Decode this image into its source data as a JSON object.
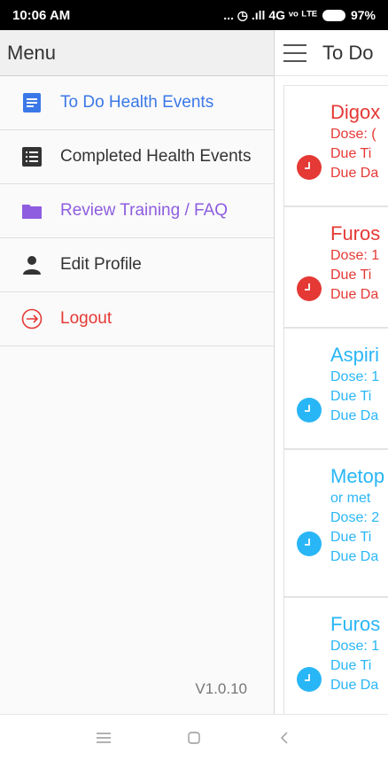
{
  "status_bar": {
    "time": "10:06 AM",
    "indicators": "... ◷ .ıll 4G ᵛᵒ ᴸᵀᴱ",
    "battery": "97%"
  },
  "drawer": {
    "title": "Menu",
    "items": [
      {
        "label": "To Do Health Events",
        "icon": "todo-list-icon",
        "color": "#3b78e7"
      },
      {
        "label": "Completed Health Events",
        "icon": "completed-list-icon",
        "color": "#333333"
      },
      {
        "label": "Review Training / FAQ",
        "icon": "folder-icon",
        "color": "#8e5de0"
      },
      {
        "label": "Edit Profile",
        "icon": "person-icon",
        "color": "#333333"
      },
      {
        "label": "Logout",
        "icon": "logout-icon",
        "color": "#e53935"
      }
    ],
    "version": "V1.0.10"
  },
  "app_bar": {
    "title": "To Do"
  },
  "events": [
    {
      "name": "Digox",
      "lines": [
        "Dose: (",
        "Due Ti",
        "Due Da"
      ],
      "status": "overdue"
    },
    {
      "name": "Furos",
      "lines": [
        "Dose: 1",
        "Due Ti",
        "Due Da"
      ],
      "status": "overdue"
    },
    {
      "name": "Aspiri",
      "lines": [
        "Dose: 1",
        "Due Ti",
        "Due Da"
      ],
      "status": "upcoming"
    },
    {
      "name": "Metop",
      "lines": [
        "or met",
        "Dose: 2",
        "Due Ti",
        "Due Da"
      ],
      "status": "upcoming"
    },
    {
      "name": "Furos",
      "lines": [
        "Dose: 1",
        "Due Ti",
        "Due Da"
      ],
      "status": "upcoming"
    }
  ],
  "colors": {
    "overdue": "#e53935",
    "upcoming": "#29b6f6",
    "accent_blue": "#3b78e7",
    "accent_purple": "#8e5de0"
  },
  "nav_bar": {
    "icons": [
      "menu-icon",
      "home-square-icon",
      "back-chevron-icon"
    ]
  }
}
